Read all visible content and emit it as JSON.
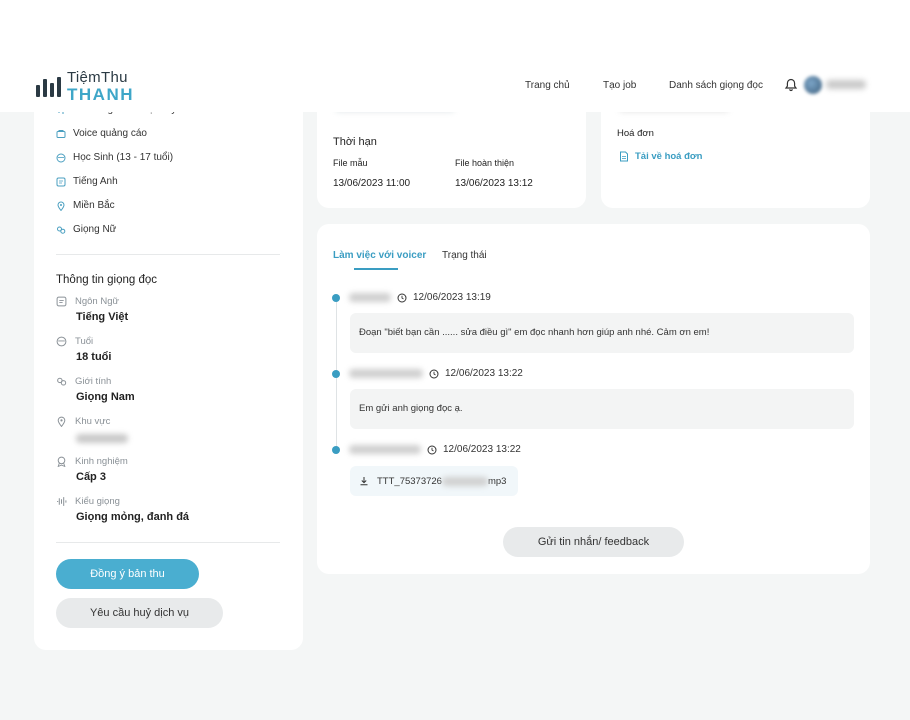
{
  "brand": {
    "line1": "TiệmThu",
    "line2": "THANH"
  },
  "nav": {
    "items": [
      "Trang chủ",
      "Tạo job",
      "Danh sách giọng đọc"
    ]
  },
  "left_panel": {
    "partial_top_item": "Nền lồng video trực tuyến",
    "tags": [
      {
        "icon": "megaphone-icon",
        "label": "Voice quảng cáo"
      },
      {
        "icon": "face-icon",
        "label": "Học Sinh (13 - 17 tuổi)"
      },
      {
        "icon": "language-icon",
        "label": "Tiếng Anh"
      },
      {
        "icon": "location-icon",
        "label": "Miền Bắc"
      },
      {
        "icon": "gender-icon",
        "label": "Giọng Nữ"
      }
    ],
    "voice_info_title": "Thông tin giọng đọc",
    "voice_info": [
      {
        "icon": "language-icon",
        "label": "Ngôn Ngữ",
        "value": "Tiếng Việt"
      },
      {
        "icon": "face-icon",
        "label": "Tuổi",
        "value": "18 tuổi"
      },
      {
        "icon": "gender-icon",
        "label": "Giới tính",
        "value": "Giọng Nam"
      },
      {
        "icon": "location-icon",
        "label": "Khu vực",
        "value": ""
      },
      {
        "icon": "experience-icon",
        "label": "Kinh nghiệm",
        "value": "Cấp 3"
      },
      {
        "icon": "waveform-icon",
        "label": "Kiểu giọng",
        "value": "Giọng mỏng, đanh đá"
      }
    ],
    "accept_button": "Đồng ý bản thu",
    "cancel_button": "Yêu cầu huỷ dịch vụ"
  },
  "deadline": {
    "title": "Thời hạn",
    "sample_label": "File mẫu",
    "sample_value": "13/06/2023 11:00",
    "final_label": "File hoàn thiện",
    "final_value": "13/06/2023 13:12"
  },
  "invoice": {
    "label": "Hoá đơn",
    "download_link": "Tải về hoá đơn"
  },
  "tabs": {
    "active": "Làm việc với voicer",
    "other": "Trạng thái"
  },
  "timeline": [
    {
      "time": "12/06/2023 13:19",
      "message": "Đoạn \"biết bạn cần ...... sửa điều gì\" em đọc nhanh hơn giúp anh nhé. Cảm ơn em!"
    },
    {
      "time": "12/06/2023 13:22",
      "message": "Em gửi anh giọng đọc ạ."
    },
    {
      "time": "12/06/2023 13:22",
      "file_prefix": "TTT_75373726",
      "file_suffix": "mp3"
    }
  ],
  "feedback_button": "Gửi tin nhắn/ feedback"
}
